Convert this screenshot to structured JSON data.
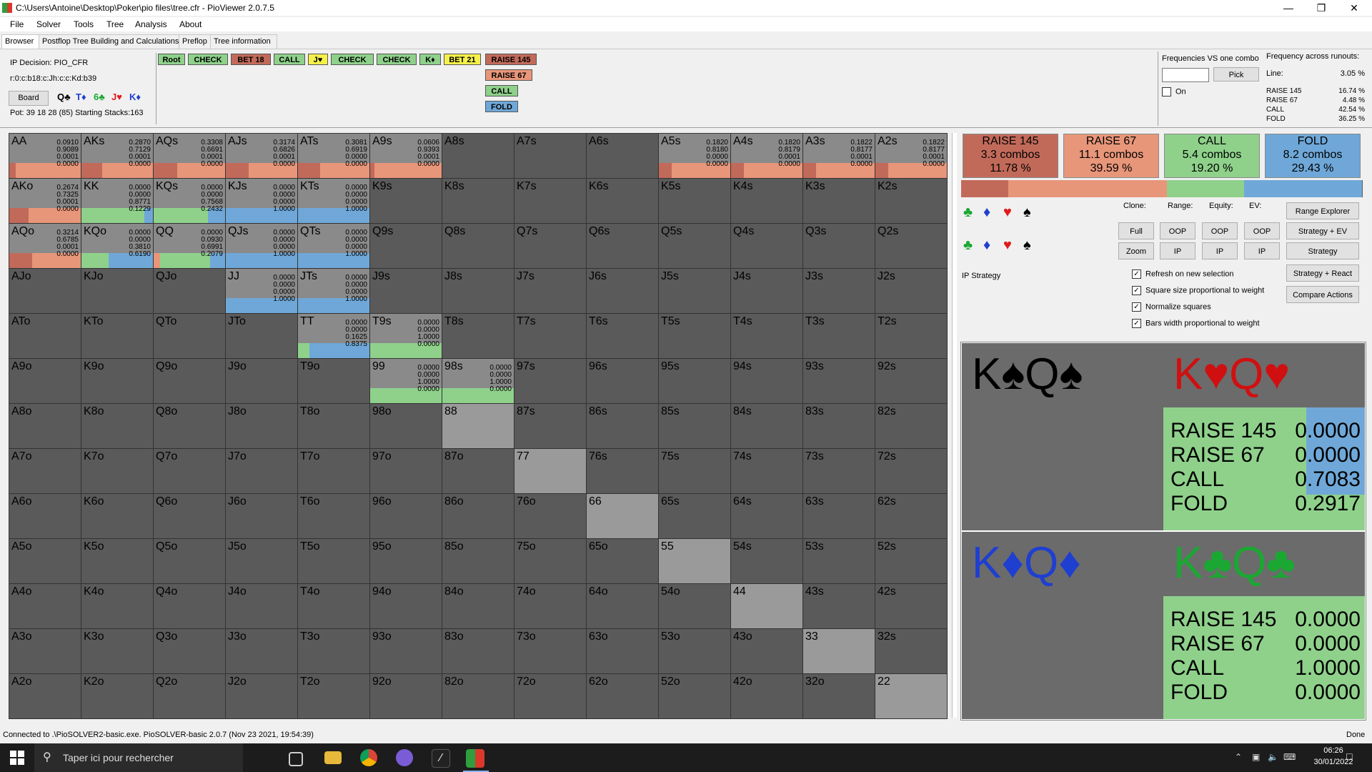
{
  "window": {
    "title": "C:\\Users\\Antoine\\Desktop\\Poker\\pio files\\tree.cfr - PioViewer 2.0.7.5"
  },
  "menu": [
    "File",
    "Solver",
    "Tools",
    "Tree",
    "Analysis",
    "About"
  ],
  "tabs": [
    "Browser",
    "Postflop Tree Building and Calculations",
    "Preflop",
    "Tree information"
  ],
  "info": {
    "decision": "IP Decision:  PIO_CFR",
    "line": "r:0:c:b18:c:Jh:c:c:Kd:b39",
    "board_label": "Board",
    "board_cards": [
      {
        "text": "Q♣",
        "color": "#000000"
      },
      {
        "text": "T♦",
        "color": "#1f3fd0"
      },
      {
        "text": "6♣",
        "color": "#1aa832"
      },
      {
        "text": "J♥",
        "color": "#e01b1b"
      },
      {
        "text": "K♦",
        "color": "#1f3fd0"
      }
    ],
    "pot": "Pot: 39 18 28 (85) Starting Stacks:163"
  },
  "path": [
    {
      "label": "Root",
      "bg": "#8fd18b"
    },
    {
      "label": "CHECK",
      "bg": "#8fd18b"
    },
    {
      "label": "BET 18",
      "bg": "#c26a5a"
    },
    {
      "label": "CALL",
      "bg": "#8fd18b"
    },
    {
      "label": "J♥",
      "bg": "#f5f04a"
    },
    {
      "label": "CHECK",
      "bg": "#8fd18b"
    },
    {
      "label": "CHECK",
      "bg": "#8fd18b"
    },
    {
      "label": "K♦",
      "bg": "#8fd18b"
    },
    {
      "label": "BET 21",
      "bg": "#f5f04a"
    },
    {
      "label": "RAISE 145",
      "bg": "#c26a5a"
    }
  ],
  "path_options": [
    {
      "label": "RAISE 67",
      "bg": "#e8967a"
    },
    {
      "label": "CALL",
      "bg": "#8fd18b"
    },
    {
      "label": "FOLD",
      "bg": "#6fa8d8"
    }
  ],
  "freq_vs_combo": {
    "title": "Frequencies VS one combo",
    "pick": "Pick",
    "on": "On"
  },
  "runouts": {
    "title": "Frequency across runouts:",
    "line_label": "Line:",
    "line_value": "3.05 %",
    "rows": [
      {
        "name": "RAISE 145",
        "value": "16.74 %"
      },
      {
        "name": "RAISE 67",
        "value": "4.48 %"
      },
      {
        "name": "CALL",
        "value": "42.54 %"
      },
      {
        "name": "FOLD",
        "value": "36.25 %"
      }
    ]
  },
  "actions": [
    {
      "name": "RAISE 145",
      "combos": "3.3 combos",
      "pct": "11.78 %",
      "bg": "#c26a5a",
      "frac": 0.1178
    },
    {
      "name": "RAISE 67",
      "combos": "11.1 combos",
      "pct": "39.59 %",
      "bg": "#e8967a",
      "frac": 0.3959
    },
    {
      "name": "CALL",
      "combos": "5.4 combos",
      "pct": "19.20 %",
      "bg": "#8fd18b",
      "frac": 0.192
    },
    {
      "name": "FOLD",
      "combos": "8.2 combos",
      "pct": "29.43 %",
      "bg": "#6fa8d8",
      "frac": 0.2943
    }
  ],
  "controls": {
    "clone": "Clone:",
    "range": "Range:",
    "equity": "Equity:",
    "ev": "EV:",
    "full": "Full",
    "zoom": "Zoom",
    "oop": "OOP",
    "ip": "IP",
    "range_explorer": "Range Explorer",
    "strategy_ev": "Strategy + EV",
    "strategy": "Strategy",
    "strategy_react": "Strategy + React",
    "compare": "Compare Actions",
    "ip_strategy": "IP Strategy",
    "checks": [
      "Refresh on new selection",
      "Square size proportional to weight",
      "Normalize squares",
      "Bars width proportional to weight"
    ]
  },
  "combos": [
    {
      "cards": "K♠Q♠",
      "color": "#000000",
      "rows": []
    },
    {
      "cards": "K♥Q♥",
      "color": "#d01010",
      "rows": [
        {
          "n": "RAISE 145",
          "v": "0.0000"
        },
        {
          "n": "RAISE 67",
          "v": "0.0000"
        },
        {
          "n": "CALL",
          "v": "0.7083"
        },
        {
          "n": "FOLD",
          "v": "0.2917"
        }
      ],
      "call": 0.7083,
      "fold": 0.2917
    },
    {
      "cards": "K♦Q♦",
      "color": "#1f3fd0",
      "rows": []
    },
    {
      "cards": "K♣Q♣",
      "color": "#1aa832",
      "rows": [
        {
          "n": "RAISE 145",
          "v": "0.0000"
        },
        {
          "n": "RAISE 67",
          "v": "0.0000"
        },
        {
          "n": "CALL",
          "v": "1.0000"
        },
        {
          "n": "FOLD",
          "v": "0.0000"
        }
      ],
      "call": 1.0,
      "fold": 0.0
    }
  ],
  "grid": {
    "ranks": [
      "A",
      "K",
      "Q",
      "J",
      "T",
      "9",
      "8",
      "7",
      "6",
      "5",
      "4",
      "3",
      "2"
    ],
    "colors": {
      "r145": "#c26a5a",
      "r67": "#e8967a",
      "call": "#8fd18b",
      "fold": "#6fa8d8",
      "empty": "#5a5a5a",
      "pair": "#9a9a9a",
      "base": "#8a8a8a"
    },
    "cells": {
      "AA": [
        0.091,
        0.9089,
        0.0001,
        0.0
      ],
      "AKs": [
        0.287,
        0.7129,
        0.0001,
        0.0
      ],
      "AQs": [
        0.3308,
        0.6691,
        0.0001,
        0.0
      ],
      "AJs": [
        0.3174,
        0.6826,
        0.0001,
        0.0
      ],
      "ATs": [
        0.3081,
        0.6919,
        0.0,
        0.0
      ],
      "A9s": [
        0.0606,
        0.9393,
        0.0001,
        0.0
      ],
      "A5s": [
        0.182,
        0.818,
        0.0,
        0.0
      ],
      "A4s": [
        0.182,
        0.8179,
        0.0001,
        0.0
      ],
      "A3s": [
        0.1822,
        0.8177,
        0.0001,
        0.0
      ],
      "A2s": [
        0.1822,
        0.8177,
        0.0001,
        0.0
      ],
      "AKo": [
        0.2674,
        0.7325,
        0.0001,
        0.0
      ],
      "KK": [
        0.0,
        0.0,
        0.8771,
        0.1229
      ],
      "KQs": [
        0.0,
        0.0,
        0.7568,
        0.2432
      ],
      "KJs": [
        0.0,
        0.0,
        0.0,
        1.0
      ],
      "KTs": [
        0.0,
        0.0,
        0.0,
        1.0
      ],
      "AQo": [
        0.3214,
        0.6785,
        0.0001,
        0.0
      ],
      "KQo": [
        0.0,
        0.0,
        0.381,
        0.619
      ],
      "QQ": [
        0.0,
        0.093,
        0.6991,
        0.2079
      ],
      "QJs": [
        0.0,
        0.0,
        0.0,
        1.0
      ],
      "QTs": [
        0.0,
        0.0,
        0.0,
        1.0
      ],
      "JJ": [
        0.0,
        0.0,
        0.0,
        1.0
      ],
      "JTs": [
        0.0,
        0.0,
        0.0,
        1.0
      ],
      "TT": [
        0.0,
        0.0,
        0.1625,
        0.8375
      ],
      "T9s": [
        0.0,
        0.0,
        1.0,
        0.0
      ],
      "99": [
        0.0,
        0.0,
        1.0,
        0.0
      ],
      "98s": [
        0.0,
        0.0,
        1.0,
        0.0
      ]
    },
    "plain": [
      "88",
      "77",
      "66",
      "55",
      "44",
      "33",
      "22"
    ]
  },
  "status": {
    "left": "Connected to .\\PioSOLVER2-basic.exe. PioSOLVER-basic 2.0.7 (Nov 23 2021, 19:54:39)",
    "right": "Done"
  },
  "taskbar": {
    "search": "Taper ici pour rechercher",
    "time": "06:26",
    "date": "30/01/2022"
  }
}
